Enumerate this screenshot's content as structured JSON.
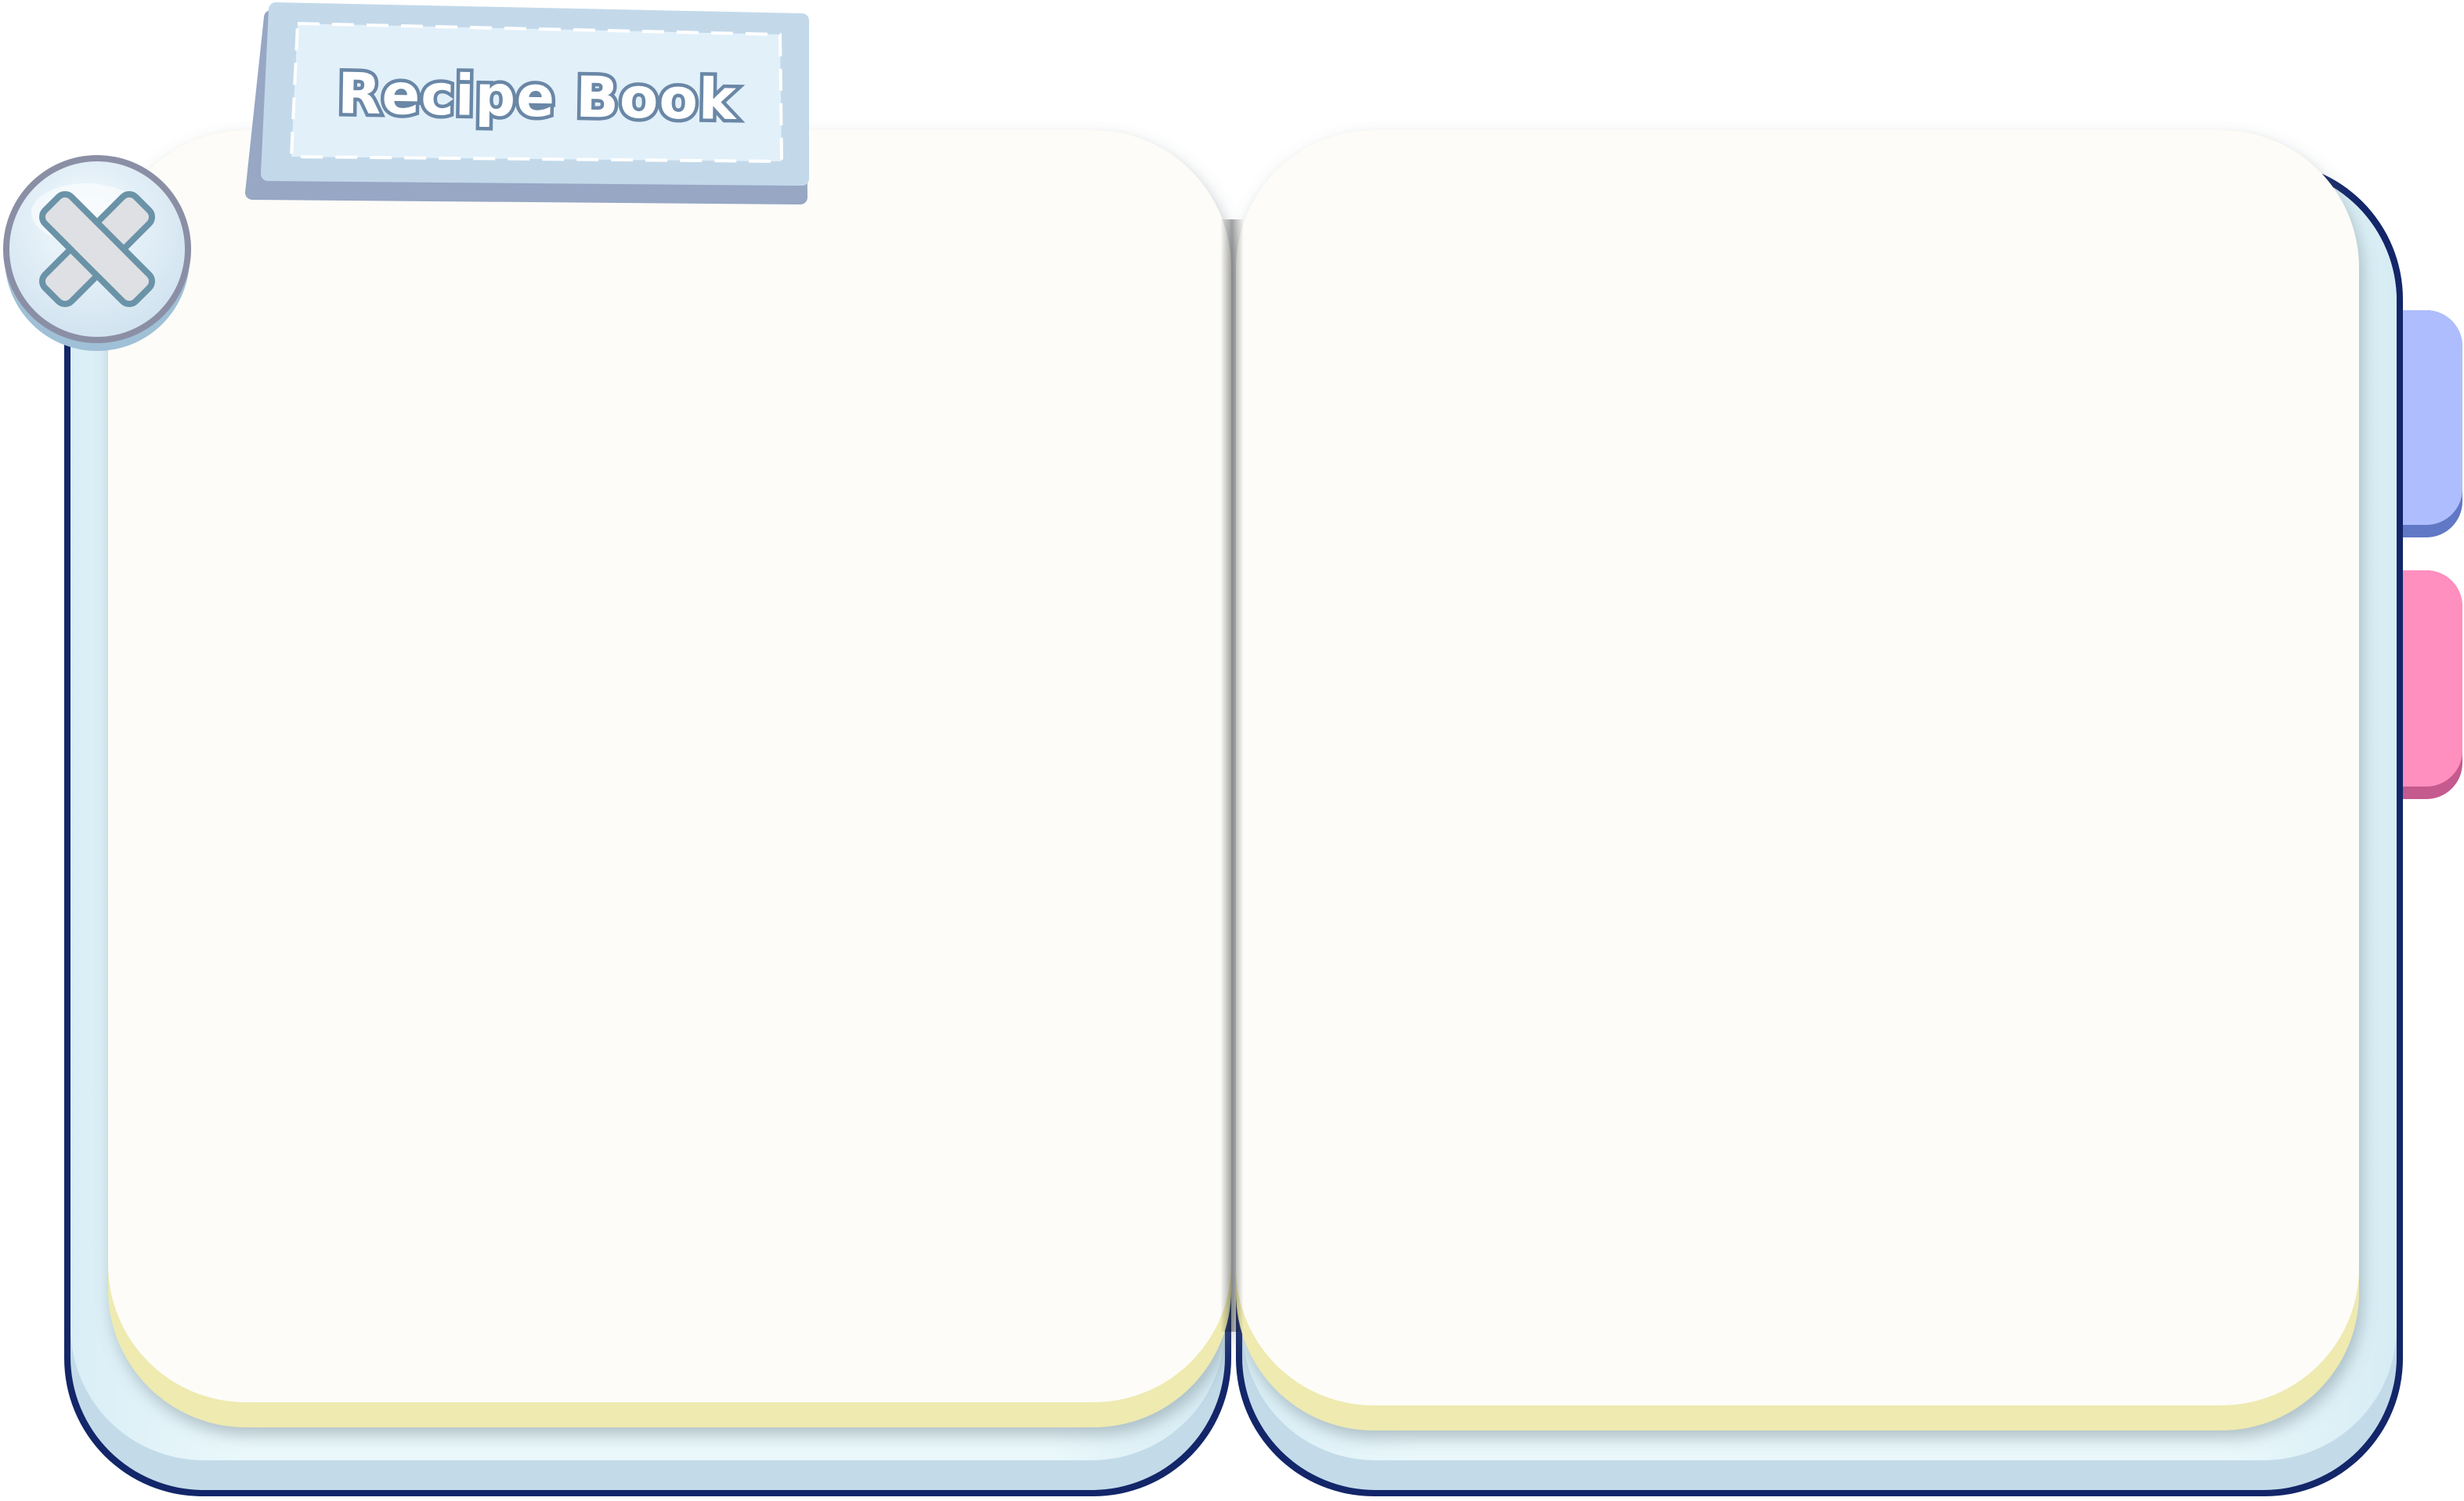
{
  "title": "Recipe Book",
  "icons": {
    "close": "close-x-icon"
  },
  "tabs": [
    {
      "name": "tab-blue",
      "color": "#aebdfd"
    },
    {
      "name": "tab-pink",
      "color": "#ff8fbe"
    }
  ],
  "colors": {
    "outline": "#132669",
    "cover": "#e6f6fb",
    "page": "#fdfcf8",
    "page_edge": "#eeeab0",
    "title_plate": "#e2f0fa"
  }
}
